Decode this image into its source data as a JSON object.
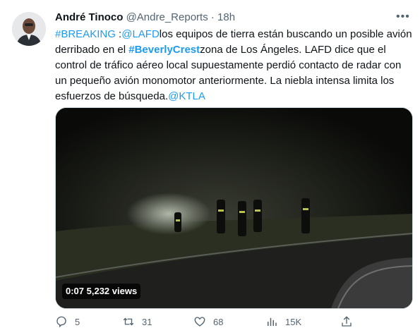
{
  "tweet": {
    "author_name": "André Tinoco",
    "handle": "@Andre_Reports",
    "separator": "·",
    "time": "18h",
    "more_label": "•••",
    "body": {
      "hashtag_breaking": "#BREAKING",
      "seg1": " :",
      "mention_lafd": "@LAFD",
      "seg2": "los equipos de tierra están buscando un posible avión derribado en el ",
      "hashtag_beverlycrest": "#BeverlyCrest",
      "seg3": "zona de Los Ángeles. LAFD dice que el control de tráfico aéreo local supuestamente perdió contacto de radar con un pequeño avión monomotor anteriormente. La niebla intensa limita los esfuerzos de búsqueda.",
      "mention_ktla": "@KTLA"
    },
    "video": {
      "overlay_text": "0:07  5,232 views"
    },
    "actions": {
      "replies": "5",
      "retweets": "31",
      "likes": "68",
      "views": "15K"
    }
  },
  "colors": {
    "link": "#1d9bf0",
    "muted": "#536471",
    "text": "#0f1419"
  }
}
